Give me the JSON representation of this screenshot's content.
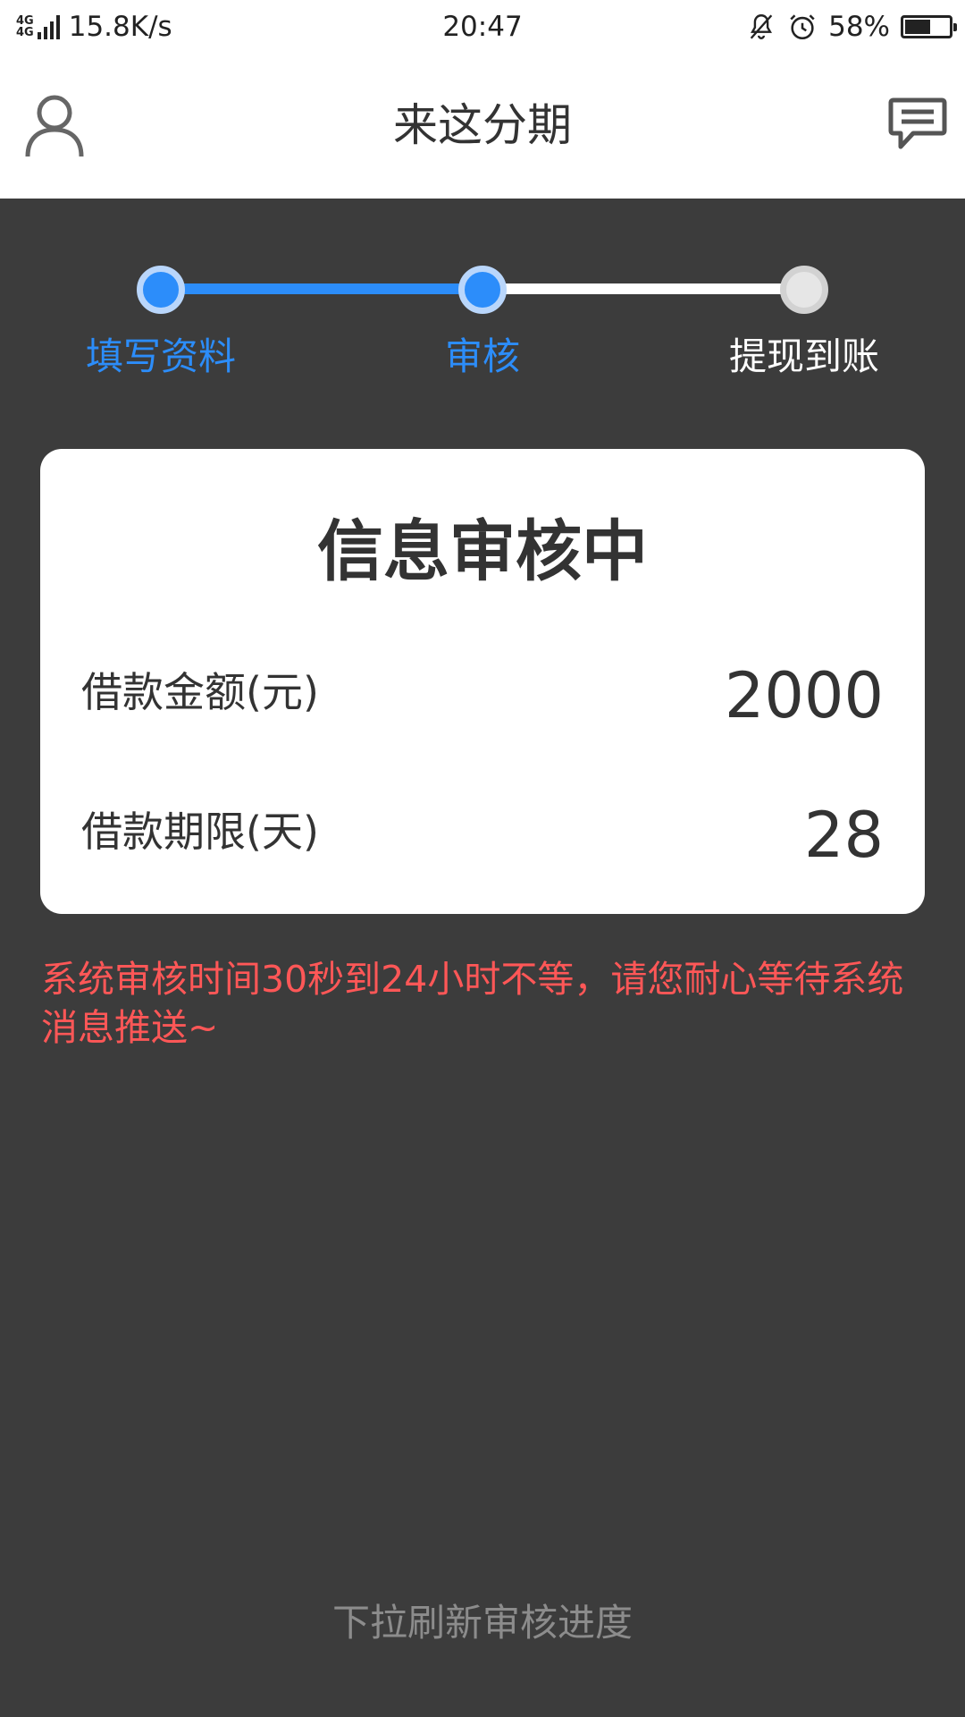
{
  "status_bar": {
    "network_top": "4G",
    "network_bottom": "4G",
    "speed": "15.8K/s",
    "time": "20:47",
    "battery": "58%",
    "battery_level": 0.58,
    "icons": [
      "bell-off-icon",
      "alarm-icon",
      "battery-icon",
      "signal-icon"
    ]
  },
  "header": {
    "title": "来这分期",
    "left_icon": "profile-icon",
    "right_icon": "message-icon"
  },
  "steps": [
    {
      "label": "填写资料",
      "state": "active"
    },
    {
      "label": "审核",
      "state": "active"
    },
    {
      "label": "提现到账",
      "state": "inactive"
    }
  ],
  "card": {
    "title": "信息审核中",
    "amount_label": "借款金额(元)",
    "amount_value": "2000",
    "term_label": "借款期限(天)",
    "term_value": "28"
  },
  "notice": "系统审核时间30秒到24小时不等，请您耐心等待系统消息推送~",
  "refresh_hint": "下拉刷新审核进度",
  "colors": {
    "accent": "#2c8dfa",
    "background": "#3c3c3c",
    "warning": "#ff5757",
    "muted": "#8c8c8c"
  }
}
